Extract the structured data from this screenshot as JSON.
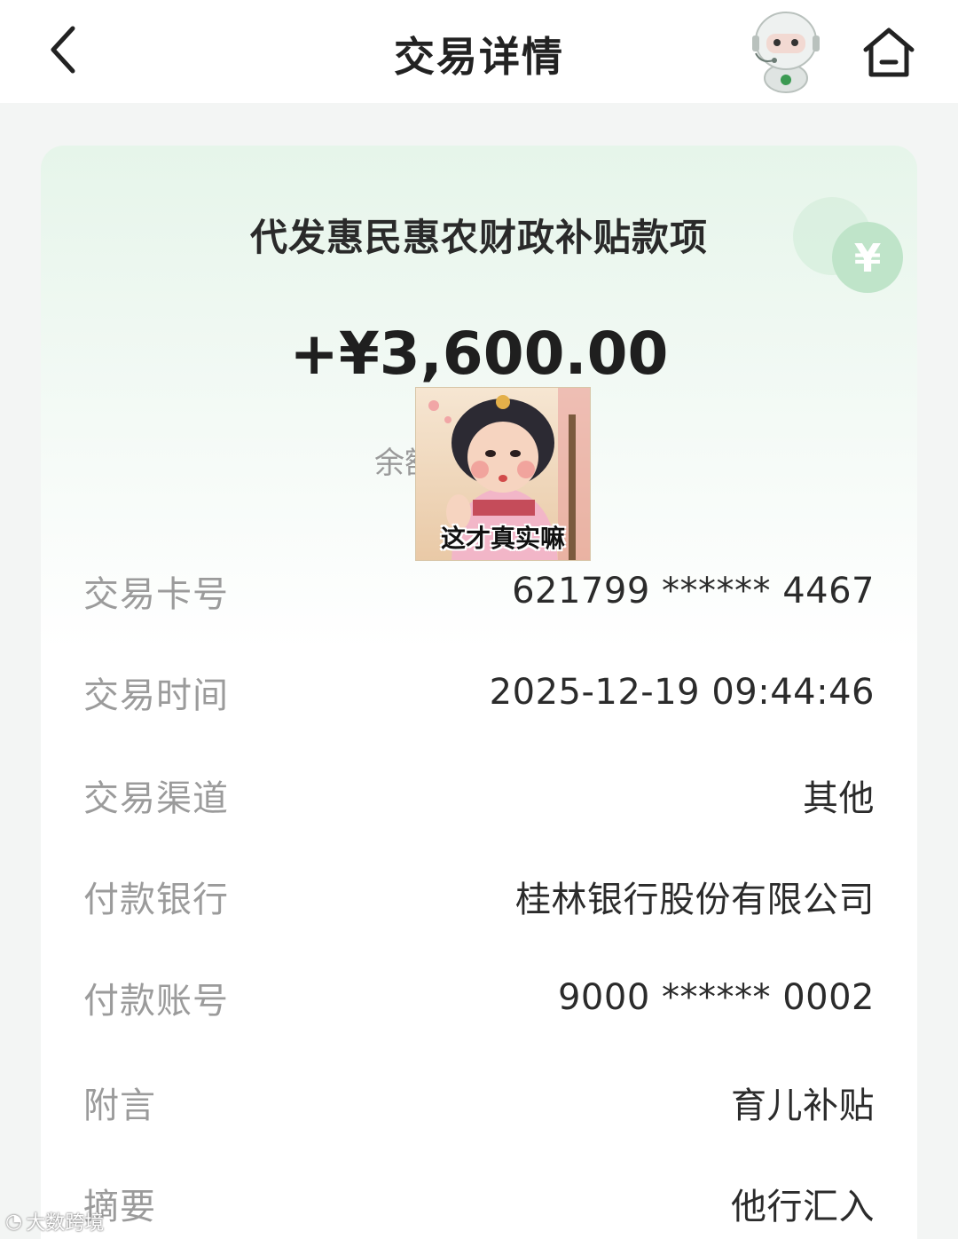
{
  "header": {
    "title": "交易详情",
    "back_icon": "chevron-left-icon",
    "assistant_icon": "robot-assistant-icon",
    "home_icon": "home-icon"
  },
  "transaction": {
    "title": "代发惠民惠农财政补贴款项",
    "amount": "+¥3,600.00",
    "balance_label": "余额",
    "deco_icon": "yen-coin-icon",
    "accent_color": "#3fb56a"
  },
  "sticker": {
    "caption": "这才真实嘛"
  },
  "details": [
    {
      "label": "交易卡号",
      "value": "621799 ****** 4467"
    },
    {
      "label": "交易时间",
      "value": "2025-12-19 09:44:46"
    },
    {
      "label": "交易渠道",
      "value": "其他"
    },
    {
      "label": "付款银行",
      "value": "桂林银行股份有限公司"
    },
    {
      "label": "付款账号",
      "value": "9000 ****** 0002"
    },
    {
      "label": "附言",
      "value": "育儿补贴"
    },
    {
      "label": "摘要",
      "value": "他行汇入"
    }
  ],
  "watermark": {
    "text": "大数跨境"
  }
}
